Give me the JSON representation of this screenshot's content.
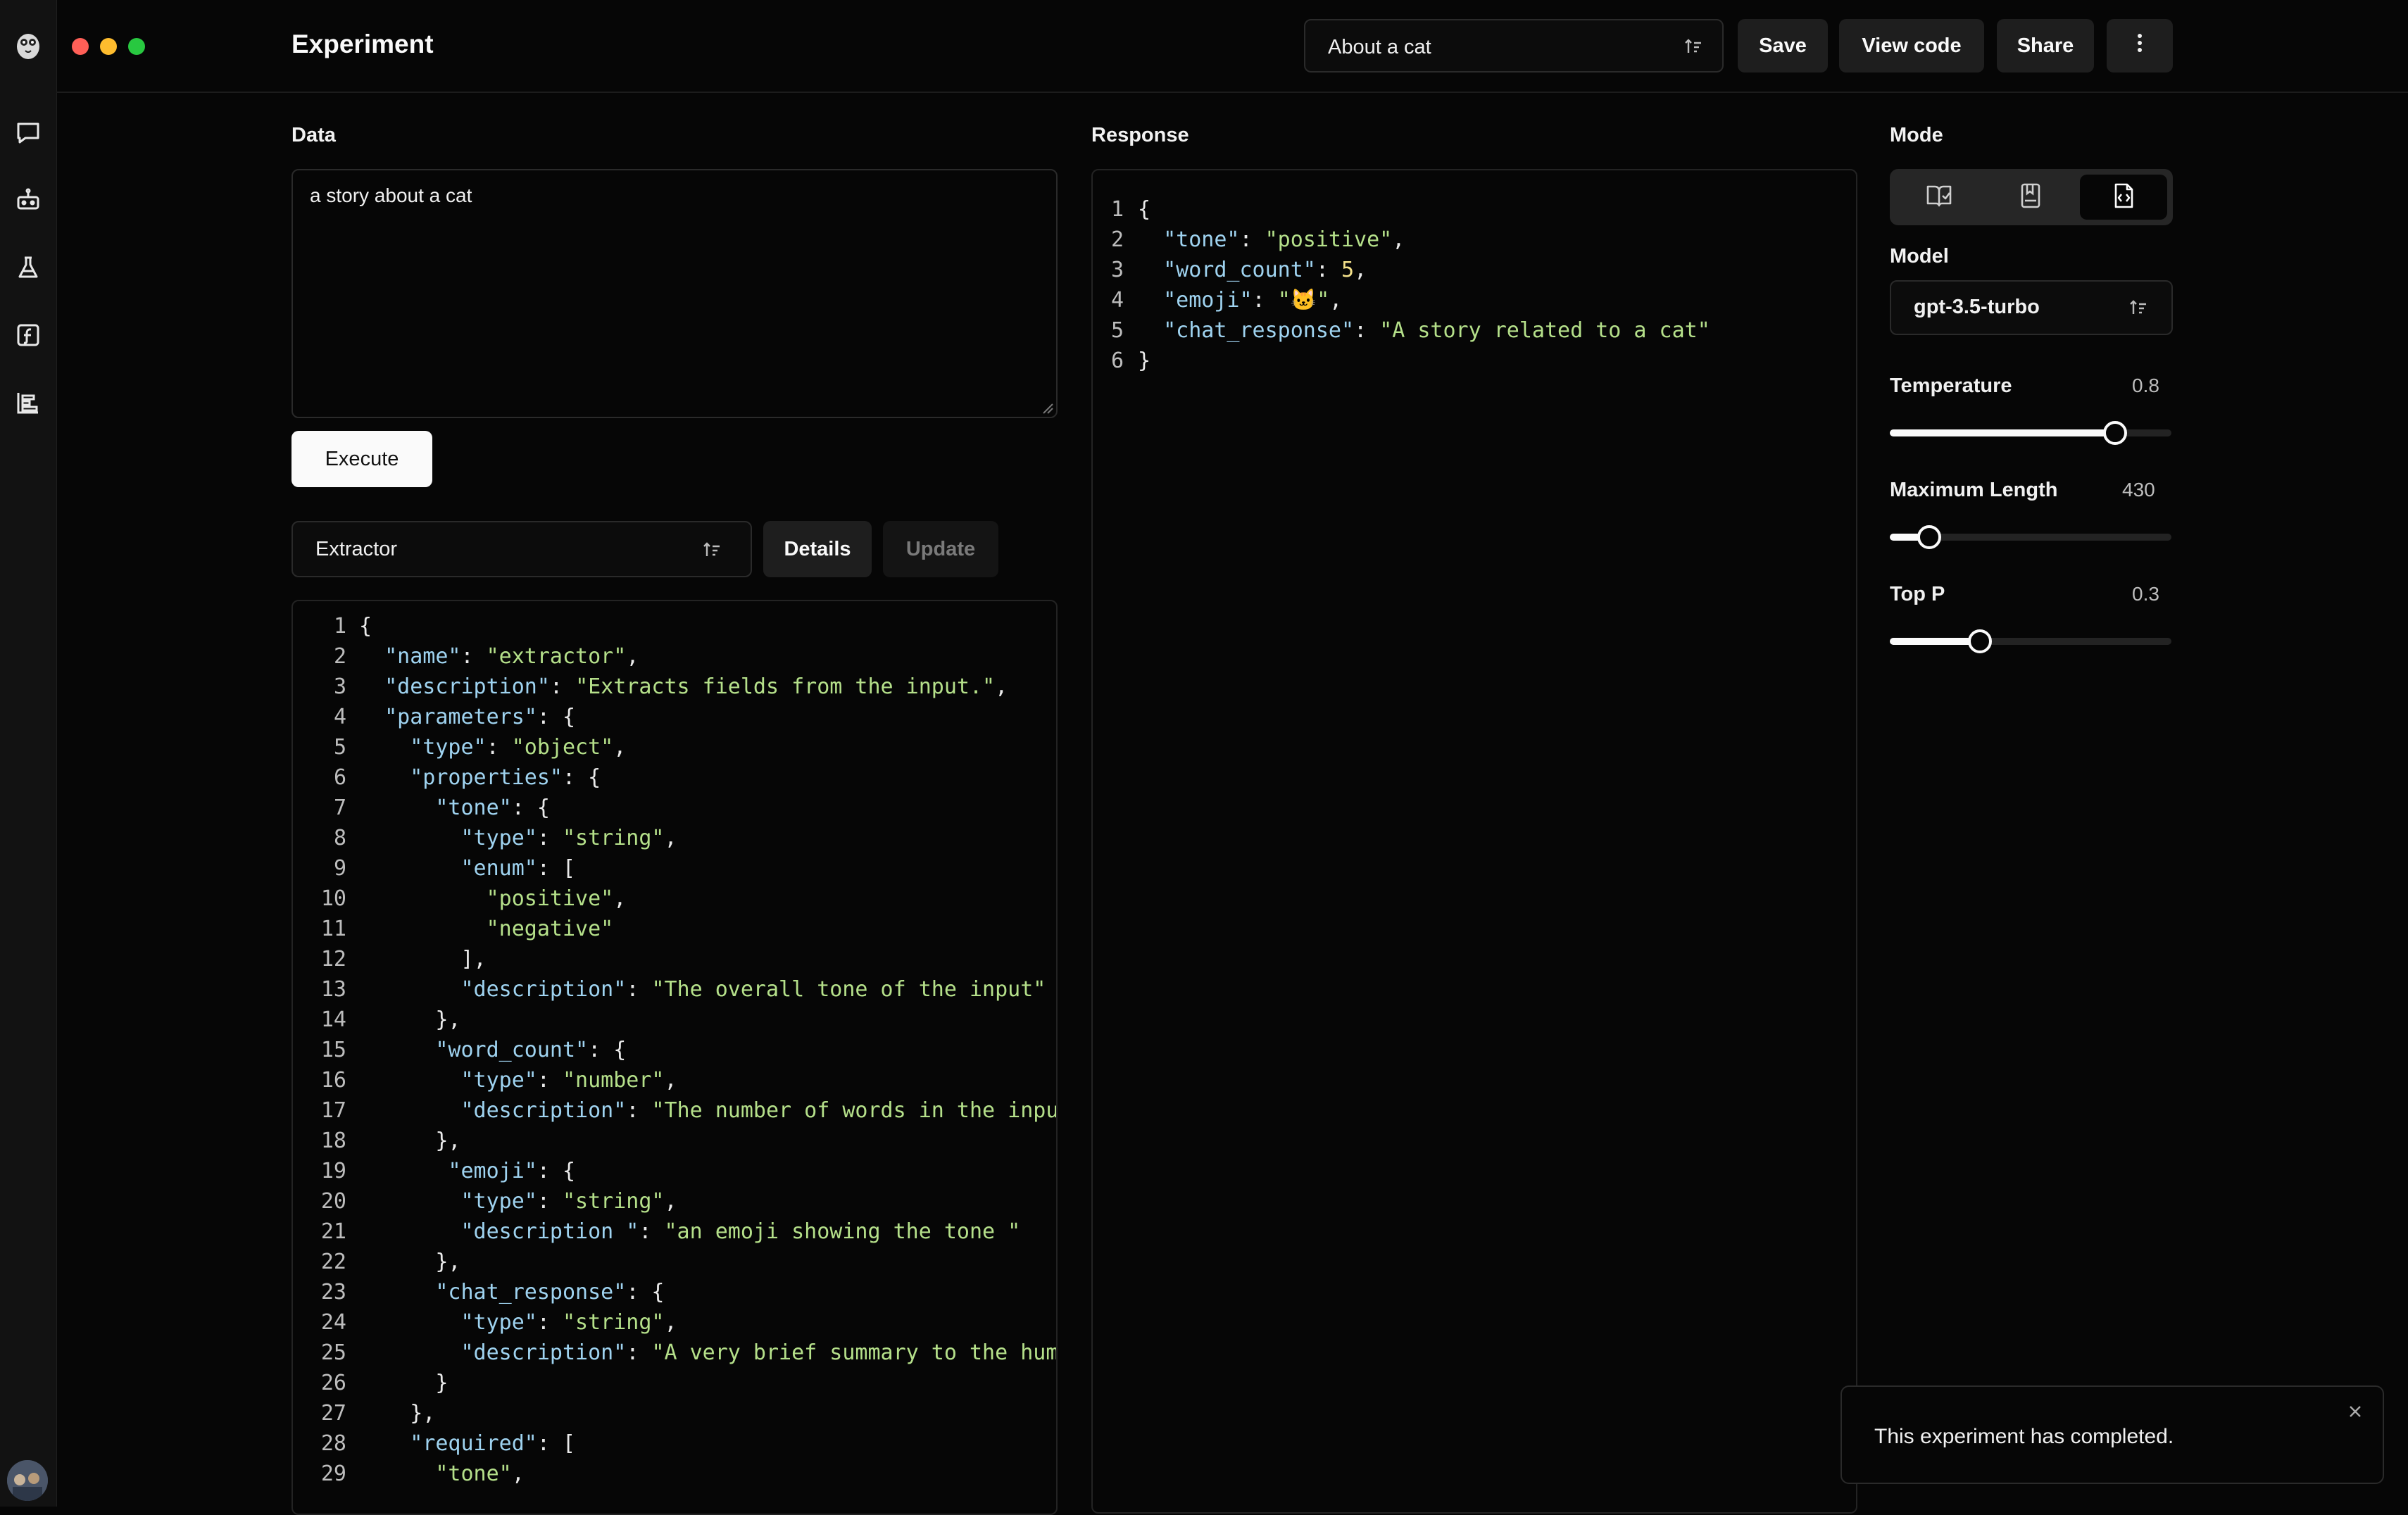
{
  "header": {
    "title": "Experiment",
    "preset": "About a cat",
    "buttons": {
      "save": "Save",
      "view_code": "View code",
      "share": "Share"
    }
  },
  "sidebar": {
    "icons": [
      "chat-icon",
      "robot-icon",
      "flask-icon",
      "function-icon",
      "chart-icon"
    ]
  },
  "data_panel": {
    "label": "Data",
    "input_value": "a story about a cat",
    "execute_label": "Execute",
    "function_select": "Extractor",
    "details_label": "Details",
    "update_label": "Update",
    "code_lines": [
      [
        [
          "p",
          "{"
        ]
      ],
      [
        [
          "p",
          "  "
        ],
        [
          "k",
          "\"name\""
        ],
        [
          "p",
          ": "
        ],
        [
          "s",
          "\"extractor\""
        ],
        [
          "p",
          ","
        ]
      ],
      [
        [
          "p",
          "  "
        ],
        [
          "k",
          "\"description\""
        ],
        [
          "p",
          ": "
        ],
        [
          "s",
          "\"Extracts fields from the input.\""
        ],
        [
          "p",
          ","
        ]
      ],
      [
        [
          "p",
          "  "
        ],
        [
          "k",
          "\"parameters\""
        ],
        [
          "p",
          ": {"
        ]
      ],
      [
        [
          "p",
          "    "
        ],
        [
          "k",
          "\"type\""
        ],
        [
          "p",
          ": "
        ],
        [
          "s",
          "\"object\""
        ],
        [
          "p",
          ","
        ]
      ],
      [
        [
          "p",
          "    "
        ],
        [
          "k",
          "\"properties\""
        ],
        [
          "p",
          ": {"
        ]
      ],
      [
        [
          "p",
          "      "
        ],
        [
          "k",
          "\"tone\""
        ],
        [
          "p",
          ": {"
        ]
      ],
      [
        [
          "p",
          "        "
        ],
        [
          "k",
          "\"type\""
        ],
        [
          "p",
          ": "
        ],
        [
          "s",
          "\"string\""
        ],
        [
          "p",
          ","
        ]
      ],
      [
        [
          "p",
          "        "
        ],
        [
          "k",
          "\"enum\""
        ],
        [
          "p",
          ": ["
        ]
      ],
      [
        [
          "p",
          "          "
        ],
        [
          "s",
          "\"positive\""
        ],
        [
          "p",
          ","
        ]
      ],
      [
        [
          "p",
          "          "
        ],
        [
          "s",
          "\"negative\""
        ]
      ],
      [
        [
          "p",
          "        ],"
        ]
      ],
      [
        [
          "p",
          "        "
        ],
        [
          "k",
          "\"description\""
        ],
        [
          "p",
          ": "
        ],
        [
          "s",
          "\"The overall tone of the input\""
        ]
      ],
      [
        [
          "p",
          "      },"
        ]
      ],
      [
        [
          "p",
          "      "
        ],
        [
          "k",
          "\"word_count\""
        ],
        [
          "p",
          ": {"
        ]
      ],
      [
        [
          "p",
          "        "
        ],
        [
          "k",
          "\"type\""
        ],
        [
          "p",
          ": "
        ],
        [
          "s",
          "\"number\""
        ],
        [
          "p",
          ","
        ]
      ],
      [
        [
          "p",
          "        "
        ],
        [
          "k",
          "\"description\""
        ],
        [
          "p",
          ": "
        ],
        [
          "s",
          "\"The number of words in the input\""
        ]
      ],
      [
        [
          "p",
          "      },"
        ]
      ],
      [
        [
          "p",
          "       "
        ],
        [
          "k",
          "\"emoji\""
        ],
        [
          "p",
          ": {"
        ]
      ],
      [
        [
          "p",
          "        "
        ],
        [
          "k",
          "\"type\""
        ],
        [
          "p",
          ": "
        ],
        [
          "s",
          "\"string\""
        ],
        [
          "p",
          ","
        ]
      ],
      [
        [
          "p",
          "        "
        ],
        [
          "k",
          "\"description \""
        ],
        [
          "p",
          ": "
        ],
        [
          "s",
          "\"an emoji showing the tone \""
        ]
      ],
      [
        [
          "p",
          "      },"
        ]
      ],
      [
        [
          "p",
          "      "
        ],
        [
          "k",
          "\"chat_response\""
        ],
        [
          "p",
          ": {"
        ]
      ],
      [
        [
          "p",
          "        "
        ],
        [
          "k",
          "\"type\""
        ],
        [
          "p",
          ": "
        ],
        [
          "s",
          "\"string\""
        ],
        [
          "p",
          ","
        ]
      ],
      [
        [
          "p",
          "        "
        ],
        [
          "k",
          "\"description\""
        ],
        [
          "p",
          ": "
        ],
        [
          "s",
          "\"A very brief summary to the human"
        ]
      ],
      [
        [
          "p",
          "      }"
        ]
      ],
      [
        [
          "p",
          "    },"
        ]
      ],
      [
        [
          "p",
          "    "
        ],
        [
          "k",
          "\"required\""
        ],
        [
          "p",
          ": ["
        ]
      ],
      [
        [
          "p",
          "      "
        ],
        [
          "s",
          "\"tone\""
        ],
        [
          "p",
          ","
        ]
      ]
    ]
  },
  "response_panel": {
    "label": "Response",
    "code_lines": [
      [
        [
          "p",
          "{"
        ]
      ],
      [
        [
          "p",
          "  "
        ],
        [
          "k",
          "\"tone\""
        ],
        [
          "p",
          ": "
        ],
        [
          "s",
          "\"positive\""
        ],
        [
          "p",
          ","
        ]
      ],
      [
        [
          "p",
          "  "
        ],
        [
          "k",
          "\"word_count\""
        ],
        [
          "p",
          ": "
        ],
        [
          "n",
          "5"
        ],
        [
          "p",
          ","
        ]
      ],
      [
        [
          "p",
          "  "
        ],
        [
          "k",
          "\"emoji\""
        ],
        [
          "p",
          ": "
        ],
        [
          "s",
          "\"🐱\""
        ],
        [
          "p",
          ","
        ]
      ],
      [
        [
          "p",
          "  "
        ],
        [
          "k",
          "\"chat_response\""
        ],
        [
          "p",
          ": "
        ],
        [
          "s",
          "\"A story related to a cat\""
        ]
      ],
      [
        [
          "p",
          "}"
        ]
      ]
    ]
  },
  "settings": {
    "mode_label": "Mode",
    "mode_options": [
      "complete-icon",
      "insert-icon",
      "edit-icon"
    ],
    "mode_selected": 2,
    "model_label": "Model",
    "model_value": "gpt-3.5-turbo",
    "temperature": {
      "label": "Temperature",
      "value": "0.8",
      "fraction": 0.8
    },
    "max_length": {
      "label": "Maximum Length",
      "value": "430",
      "fraction": 0.14
    },
    "top_p": {
      "label": "Top P",
      "value": "0.3",
      "fraction": 0.32
    }
  },
  "toast": {
    "message": "This experiment has completed."
  },
  "colors": {
    "background": "#060606",
    "key": "#9fd3f0",
    "string": "#b5e08a",
    "number": "#f3e08a",
    "close_dot": "#ff5f57",
    "minimize_dot": "#febc2e",
    "maximize_dot": "#28c840"
  }
}
